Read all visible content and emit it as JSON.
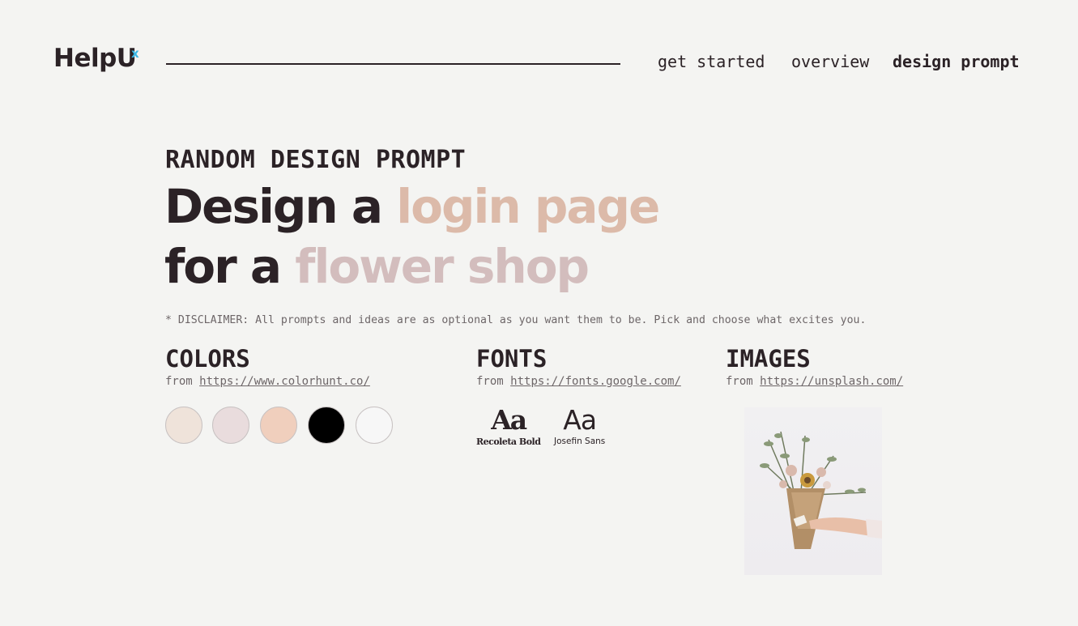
{
  "header": {
    "logo": "HelpU",
    "logo_sup": "x",
    "nav": [
      {
        "label": "get started",
        "active": false
      },
      {
        "label": "overview",
        "active": false
      },
      {
        "label": "design prompt",
        "active": true
      }
    ]
  },
  "prompt": {
    "eyebrow": "RANDOM DESIGN PROMPT",
    "line1_prefix": "Design a ",
    "line1_accent": "login page",
    "line2_prefix": "for a ",
    "line2_accent": "flower shop",
    "accent1_color": "#dcbaa9",
    "accent2_color": "#d3bdbd",
    "disclaimer": "* DISCLAIMER: All prompts and ideas are as optional as you want them to be. Pick and choose what excites you."
  },
  "colors": {
    "title": "COLORS",
    "from_label": "from",
    "link": "https://www.colorhunt.co/",
    "swatches": [
      "#efe3da",
      "#e9dcdd",
      "#f0cfbd",
      "#000000",
      "#f7f7f7"
    ]
  },
  "fonts": {
    "title": "FONTS",
    "from_label": "from",
    "link": "https://fonts.google.com/",
    "samples": [
      {
        "glyph": "Aa",
        "name": "Recoleta Bold"
      },
      {
        "glyph": "Aa",
        "name": "Josefin Sans"
      }
    ]
  },
  "images": {
    "title": "IMAGES",
    "from_label": "from",
    "link": "https://unsplash.com/",
    "photo_icon": "flower-bouquet-photo"
  }
}
